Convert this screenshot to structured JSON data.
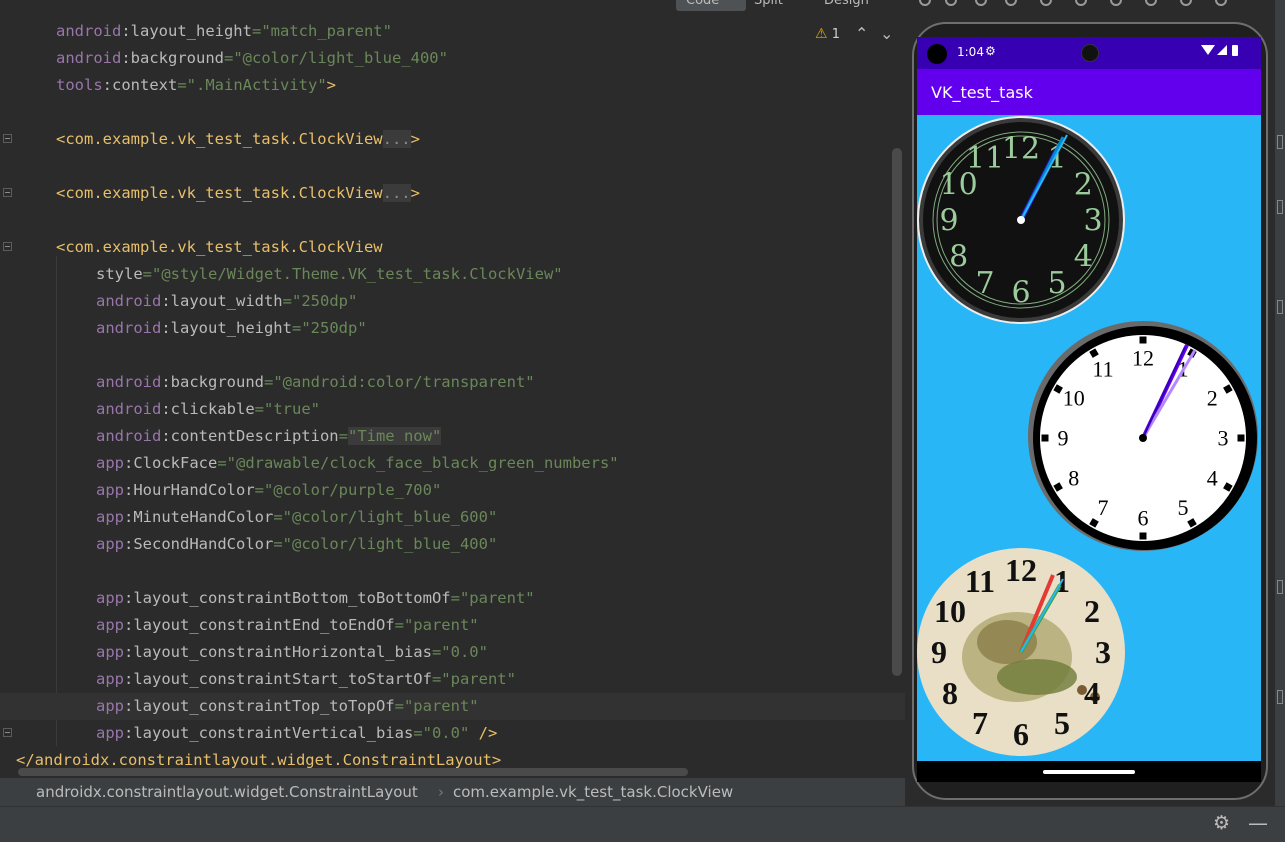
{
  "view_modes": {
    "code": "Code",
    "split": "Split",
    "design": "Design"
  },
  "warnings": {
    "count": "1"
  },
  "code_lines": [
    {
      "indent": 1,
      "tokens": [
        [
          "ns",
          "android"
        ],
        [
          "attr",
          ":layout_height"
        ],
        [
          "eq",
          "="
        ],
        [
          "val",
          "\"match_parent\""
        ]
      ]
    },
    {
      "indent": 1,
      "tokens": [
        [
          "ns",
          "android"
        ],
        [
          "attr",
          ":background"
        ],
        [
          "eq",
          "="
        ],
        [
          "val",
          "\"@color/light_blue_400\""
        ]
      ]
    },
    {
      "indent": 1,
      "tokens": [
        [
          "ns",
          "tools"
        ],
        [
          "attr",
          ":context"
        ],
        [
          "eq",
          "="
        ],
        [
          "val",
          "\".MainActivity\""
        ],
        [
          "tag",
          ">"
        ]
      ]
    },
    {
      "indent": 0,
      "tokens": []
    },
    {
      "indent": 1,
      "tokens": [
        [
          "tag",
          "<com.example.vk_test_task.ClockView"
        ],
        [
          "fold",
          "..."
        ],
        [
          "tag",
          ">"
        ]
      ]
    },
    {
      "indent": 0,
      "tokens": []
    },
    {
      "indent": 1,
      "tokens": [
        [
          "tag",
          "<com.example.vk_test_task.ClockView"
        ],
        [
          "fold",
          "..."
        ],
        [
          "tag",
          ">"
        ]
      ]
    },
    {
      "indent": 0,
      "tokens": []
    },
    {
      "indent": 1,
      "tokens": [
        [
          "tag",
          "<com.example.vk_test_task.ClockView"
        ]
      ]
    },
    {
      "indent": 2,
      "tokens": [
        [
          "attr",
          "style"
        ],
        [
          "eq",
          "="
        ],
        [
          "val",
          "\"@style/Widget.Theme.VK_test_task.ClockView\""
        ]
      ]
    },
    {
      "indent": 2,
      "tokens": [
        [
          "ns",
          "android"
        ],
        [
          "attr",
          ":layout_width"
        ],
        [
          "eq",
          "="
        ],
        [
          "val",
          "\"250dp\""
        ]
      ]
    },
    {
      "indent": 2,
      "tokens": [
        [
          "ns",
          "android"
        ],
        [
          "attr",
          ":layout_height"
        ],
        [
          "eq",
          "="
        ],
        [
          "val",
          "\"250dp\""
        ]
      ]
    },
    {
      "indent": 0,
      "tokens": []
    },
    {
      "indent": 2,
      "tokens": [
        [
          "ns",
          "android"
        ],
        [
          "attr",
          ":background"
        ],
        [
          "eq",
          "="
        ],
        [
          "val",
          "\"@android:color/transparent\""
        ]
      ]
    },
    {
      "indent": 2,
      "tokens": [
        [
          "ns",
          "android"
        ],
        [
          "attr",
          ":clickable"
        ],
        [
          "eq",
          "="
        ],
        [
          "val",
          "\"true\""
        ]
      ]
    },
    {
      "indent": 2,
      "tokens": [
        [
          "ns",
          "android"
        ],
        [
          "attr",
          ":contentDescription"
        ],
        [
          "eq",
          "="
        ],
        [
          "valhl",
          "\"Time now\""
        ]
      ]
    },
    {
      "indent": 2,
      "tokens": [
        [
          "ns",
          "app"
        ],
        [
          "attr",
          ":ClockFace"
        ],
        [
          "eq",
          "="
        ],
        [
          "val",
          "\"@drawable/clock_face_black_green_numbers\""
        ]
      ]
    },
    {
      "indent": 2,
      "tokens": [
        [
          "ns",
          "app"
        ],
        [
          "attr",
          ":HourHandColor"
        ],
        [
          "eq",
          "="
        ],
        [
          "val",
          "\"@color/purple_700\""
        ]
      ]
    },
    {
      "indent": 2,
      "tokens": [
        [
          "ns",
          "app"
        ],
        [
          "attr",
          ":MinuteHandColor"
        ],
        [
          "eq",
          "="
        ],
        [
          "val",
          "\"@color/light_blue_600\""
        ]
      ]
    },
    {
      "indent": 2,
      "tokens": [
        [
          "ns",
          "app"
        ],
        [
          "attr",
          ":SecondHandColor"
        ],
        [
          "eq",
          "="
        ],
        [
          "val",
          "\"@color/light_blue_400\""
        ]
      ]
    },
    {
      "indent": 0,
      "tokens": []
    },
    {
      "indent": 2,
      "tokens": [
        [
          "ns",
          "app"
        ],
        [
          "attr",
          ":layout_constraintBottom_toBottomOf"
        ],
        [
          "eq",
          "="
        ],
        [
          "val",
          "\"parent\""
        ]
      ]
    },
    {
      "indent": 2,
      "tokens": [
        [
          "ns",
          "app"
        ],
        [
          "attr",
          ":layout_constraintEnd_toEndOf"
        ],
        [
          "eq",
          "="
        ],
        [
          "val",
          "\"parent\""
        ]
      ]
    },
    {
      "indent": 2,
      "tokens": [
        [
          "ns",
          "app"
        ],
        [
          "attr",
          ":layout_constraintHorizontal_bias"
        ],
        [
          "eq",
          "="
        ],
        [
          "val",
          "\"0.0\""
        ]
      ]
    },
    {
      "indent": 2,
      "tokens": [
        [
          "ns",
          "app"
        ],
        [
          "attr",
          ":layout_constraintStart_toStartOf"
        ],
        [
          "eq",
          "="
        ],
        [
          "val",
          "\"parent\""
        ]
      ]
    },
    {
      "indent": 2,
      "current": true,
      "tokens": [
        [
          "ns",
          "app"
        ],
        [
          "attr",
          ":layout_constraintTop_toTopOf"
        ],
        [
          "eq",
          "="
        ],
        [
          "val",
          "\"parent\""
        ]
      ]
    },
    {
      "indent": 2,
      "tokens": [
        [
          "ns",
          "app"
        ],
        [
          "attr",
          ":layout_constraintVertical_bias"
        ],
        [
          "eq",
          "="
        ],
        [
          "val",
          "\"0.0\""
        ],
        [
          "tag",
          " />"
        ]
      ]
    },
    {
      "indent": 0,
      "tokens": [
        [
          "tag",
          "</androidx.constraintlayout.widget.ConstraintLayout>"
        ]
      ]
    }
  ],
  "breadcrumb": {
    "item1": "androidx.constraintlayout.widget.ConstraintLayout",
    "separator": "›",
    "item2": "com.example.vk_test_task.ClockView"
  },
  "device": {
    "status_time": "1:04",
    "app_title": "VK_test_task",
    "background_color": "#29b6f6",
    "appbar_color": "#6200ee",
    "statusbar_color": "#3700b3"
  },
  "clocks": [
    {
      "face": "black-green-numbers",
      "numerals": [
        "12",
        "1",
        "2",
        "3",
        "4",
        "5",
        "6",
        "7",
        "8",
        "9",
        "10",
        "11"
      ]
    },
    {
      "face": "white-classic",
      "numerals": [
        "12",
        "1",
        "2",
        "3",
        "4",
        "5",
        "6",
        "7",
        "8",
        "9",
        "10",
        "11"
      ]
    },
    {
      "face": "vintage-illustrated",
      "numerals": [
        "12",
        "1",
        "2",
        "3",
        "4",
        "5",
        "6",
        "7",
        "8",
        "9",
        "10",
        "11"
      ]
    }
  ],
  "icons": [
    "warning-icon",
    "chevron-up-icon",
    "chevron-down-icon",
    "gear-icon",
    "minimize-icon",
    "wifi-icon",
    "signal-icon",
    "battery-icon"
  ]
}
